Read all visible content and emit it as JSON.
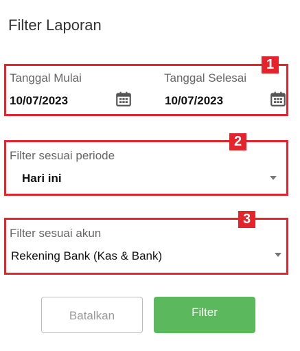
{
  "page": {
    "title": "Filter Laporan"
  },
  "badges": [
    "1",
    "2",
    "3"
  ],
  "date_range": {
    "start": {
      "label": "Tanggal Mulai",
      "value": "10/07/2023",
      "icon": "calendar-icon"
    },
    "end": {
      "label": "Tanggal Selesai",
      "value": "10/07/2023",
      "icon": "calendar-icon"
    }
  },
  "period_filter": {
    "label": "Filter sesuai periode",
    "value": "Hari ini",
    "icon": "caret-down-icon"
  },
  "account_filter": {
    "label": "Filter sesuai akun",
    "value": "Rekening Bank (Kas & Bank)",
    "icon": "caret-down-icon"
  },
  "actions": {
    "cancel_label": "Batalkan",
    "filter_label": "Filter"
  },
  "colors": {
    "highlight": "#e3242b",
    "primary": "#5cb85c"
  }
}
